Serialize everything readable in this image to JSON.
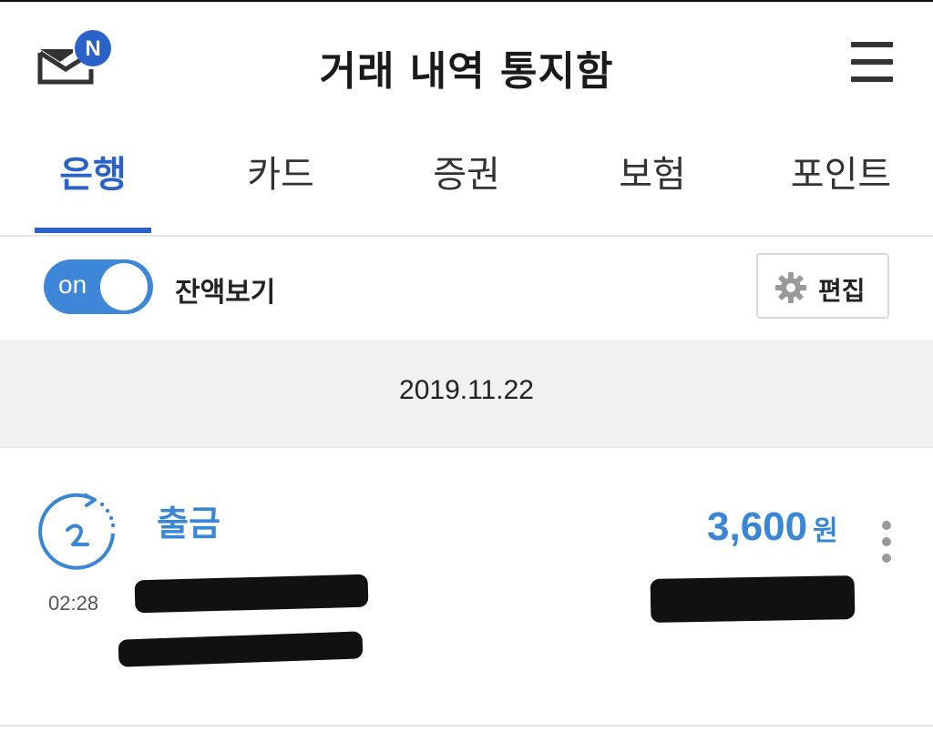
{
  "header": {
    "title": "거래 내역 통지함",
    "logo_letter": "N"
  },
  "tabs": [
    {
      "label": "은행",
      "active": true
    },
    {
      "label": "카드",
      "active": false
    },
    {
      "label": "증권",
      "active": false
    },
    {
      "label": "보험",
      "active": false
    },
    {
      "label": "포인트",
      "active": false
    }
  ],
  "balance_toggle": {
    "state_text": "on",
    "label": "잔액보기"
  },
  "edit_button": {
    "label": "편집",
    "icon": "gear-icon"
  },
  "date_group": {
    "date": "2019.11.22"
  },
  "transaction": {
    "type": "출금",
    "time": "02:28",
    "amount": "3,600",
    "currency_unit": "원",
    "icon": "clock-icon"
  },
  "colors": {
    "accent": "#2a62c9",
    "toggle_on": "#3d86d8",
    "amount": "#3a86d6",
    "date_bar_bg": "#f1f1f1"
  }
}
